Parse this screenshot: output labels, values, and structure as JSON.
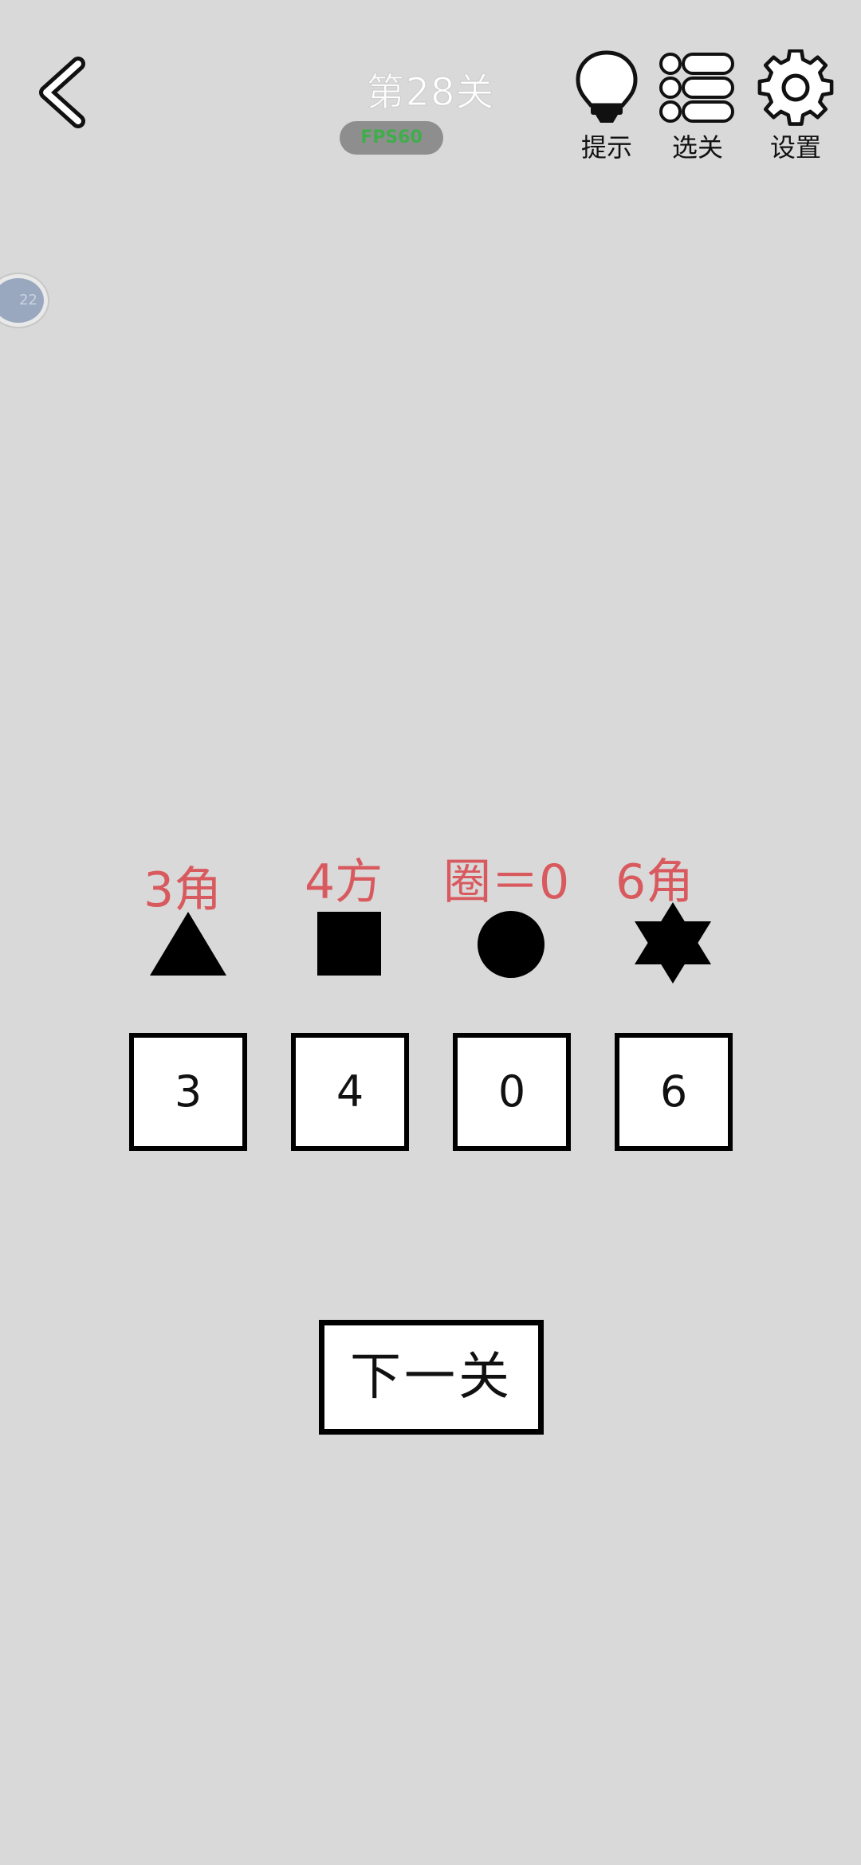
{
  "header": {
    "title": "第28关",
    "fps_badge": "FPS60",
    "hint_label": "提示",
    "levels_label": "选关",
    "settings_label": "设置"
  },
  "side_bubble": {
    "text": "22"
  },
  "puzzle": {
    "clues": [
      "3角",
      "4方",
      "圈＝0",
      "6角"
    ],
    "shapes": [
      "triangle-icon",
      "square-icon",
      "circle-icon",
      "hexagram-icon"
    ],
    "answers": [
      "3",
      "4",
      "0",
      "6"
    ]
  },
  "next_button": {
    "label": "下一关"
  },
  "colors": {
    "background": "#d9d9d9",
    "clue_red": "#d85a5e",
    "fps_green": "#3fae4a"
  }
}
